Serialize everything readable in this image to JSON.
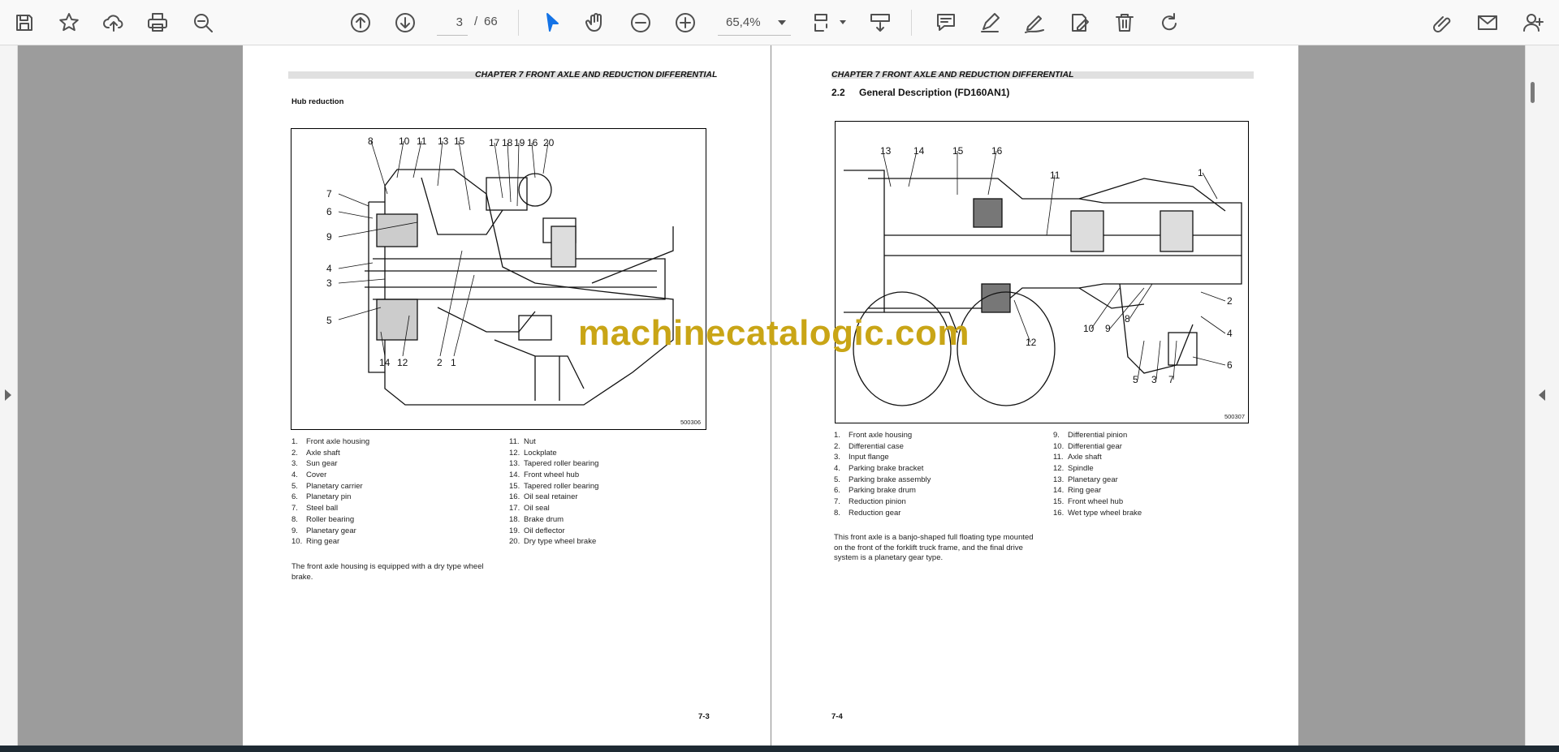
{
  "toolbar": {
    "page_current": "3",
    "page_separator": "/",
    "page_total": "66",
    "zoom_value": "65,4%"
  },
  "left_page": {
    "chapter_title": "CHAPTER 7 FRONT AXLE AND REDUCTION DIFFERENTIAL",
    "section_title": "Hub reduction",
    "figure_code": "500306",
    "callouts_top": [
      "8",
      "10",
      "11",
      "13",
      "15",
      "17",
      "18",
      "19",
      "16",
      "20"
    ],
    "callouts_left": [
      "7",
      "6",
      "9",
      "4",
      "3",
      "5"
    ],
    "callouts_bottom": [
      "14",
      "12",
      "2",
      "1"
    ],
    "parts_col1": [
      {
        "num": "1.",
        "name": "Front axle housing"
      },
      {
        "num": "2.",
        "name": "Axle shaft"
      },
      {
        "num": "3.",
        "name": "Sun gear"
      },
      {
        "num": "4.",
        "name": "Cover"
      },
      {
        "num": "5.",
        "name": "Planetary carrier"
      },
      {
        "num": "6.",
        "name": "Planetary pin"
      },
      {
        "num": "7.",
        "name": "Steel ball"
      },
      {
        "num": "8.",
        "name": "Roller bearing"
      },
      {
        "num": "9.",
        "name": "Planetary gear"
      },
      {
        "num": "10.",
        "name": "Ring gear"
      }
    ],
    "parts_col2": [
      {
        "num": "11.",
        "name": "Nut"
      },
      {
        "num": "12.",
        "name": "Lockplate"
      },
      {
        "num": "13.",
        "name": "Tapered roller bearing"
      },
      {
        "num": "14.",
        "name": "Front wheel hub"
      },
      {
        "num": "15.",
        "name": "Tapered roller bearing"
      },
      {
        "num": "16.",
        "name": "Oil seal retainer"
      },
      {
        "num": "17.",
        "name": "Oil seal"
      },
      {
        "num": "18.",
        "name": "Brake drum"
      },
      {
        "num": "19.",
        "name": "Oil deflector"
      },
      {
        "num": "20.",
        "name": "Dry type wheel brake"
      }
    ],
    "body_text": "The front axle housing is equipped with a dry type wheel brake.",
    "page_number": "7-3"
  },
  "right_page": {
    "chapter_title": "CHAPTER 7 FRONT AXLE AND REDUCTION DIFFERENTIAL",
    "section_number": "2.2",
    "section_title": "General Description (FD160AN1)",
    "figure_code": "500307",
    "callouts_top": [
      "13",
      "14",
      "15",
      "16",
      "11",
      "1"
    ],
    "callouts_other": [
      "2",
      "8",
      "4",
      "10",
      "9",
      "12",
      "6",
      "5",
      "3",
      "7"
    ],
    "parts_col1": [
      {
        "num": "1.",
        "name": "Front axle housing"
      },
      {
        "num": "2.",
        "name": "Differential case"
      },
      {
        "num": "3.",
        "name": "Input flange"
      },
      {
        "num": "4.",
        "name": "Parking brake bracket"
      },
      {
        "num": "5.",
        "name": "Parking brake assembly"
      },
      {
        "num": "6.",
        "name": "Parking brake drum"
      },
      {
        "num": "7.",
        "name": "Reduction pinion"
      },
      {
        "num": "8.",
        "name": "Reduction gear"
      }
    ],
    "parts_col2": [
      {
        "num": "9.",
        "name": "Differential pinion"
      },
      {
        "num": "10.",
        "name": "Differential gear"
      },
      {
        "num": "11.",
        "name": "Axle shaft"
      },
      {
        "num": "12.",
        "name": "Spindle"
      },
      {
        "num": "13.",
        "name": "Planetary gear"
      },
      {
        "num": "14.",
        "name": "Ring gear"
      },
      {
        "num": "15.",
        "name": "Front wheel hub"
      },
      {
        "num": "16.",
        "name": "Wet type wheel brake"
      }
    ],
    "body_text": "This front axle is a banjo-shaped full floating type mounted on the front of the forklift truck frame, and the final drive system is a planetary gear type.",
    "page_number": "7-4"
  },
  "watermark": "machinecatalogic.com",
  "icons": {
    "save": "save-icon",
    "bookmark": "star-icon",
    "upload": "cloud-upload-icon",
    "print": "print-icon",
    "zoom-search": "zoom-search-icon",
    "prev": "arrow-up-circle-icon",
    "next": "arrow-down-circle-icon",
    "select": "cursor-icon",
    "hand": "hand-icon",
    "zoom-out": "minus-circle-icon",
    "zoom-in": "plus-circle-icon",
    "fit": "fit-page-icon",
    "scroll-mode": "scroll-mode-icon",
    "comment": "comment-icon",
    "highlight": "pen-icon",
    "draw": "draw-icon",
    "fill-sign": "fill-sign-icon",
    "delete": "trash-icon",
    "rotate": "rotate-icon",
    "attach": "attach-edit-icon",
    "email": "mail-icon",
    "add-user": "add-user-icon"
  },
  "colors": {
    "accent": "#1473e6",
    "watermark": "#c9a516",
    "canvas": "#9c9c9c"
  }
}
